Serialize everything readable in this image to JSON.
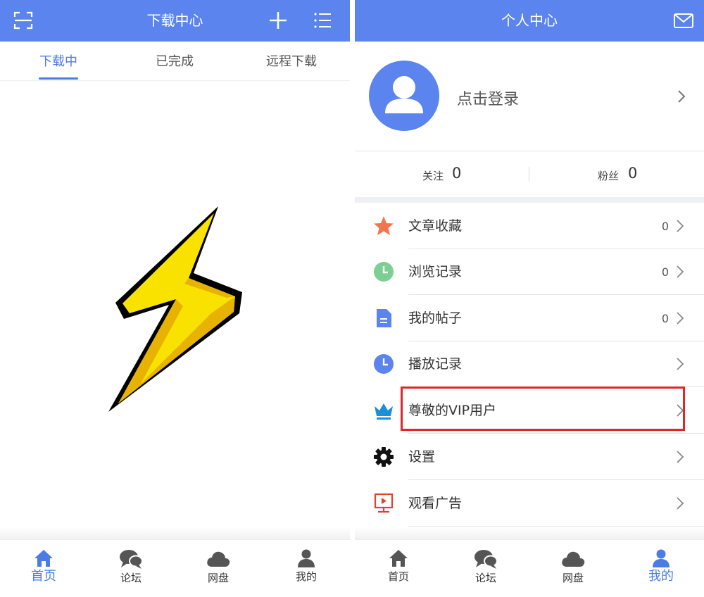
{
  "left": {
    "header": {
      "title": "下载中心",
      "scan_icon": "scan-icon",
      "add_icon": "plus-icon",
      "list_icon": "list-icon"
    },
    "tabs": [
      {
        "label": "下载中",
        "active": true
      },
      {
        "label": "已完成",
        "active": false
      },
      {
        "label": "远程下载",
        "active": false
      }
    ],
    "logo": "lightning-bolt-logo",
    "nav": [
      {
        "label": "首页",
        "icon": "home-icon",
        "active": true
      },
      {
        "label": "论坛",
        "icon": "chat-icon",
        "active": false
      },
      {
        "label": "网盘",
        "icon": "cloud-icon",
        "active": false
      },
      {
        "label": "我的",
        "icon": "user-icon",
        "active": false
      }
    ]
  },
  "right": {
    "header": {
      "title": "个人中心",
      "mail_icon": "mail-icon"
    },
    "profile": {
      "login_text": "点击登录",
      "avatar_icon": "avatar-icon"
    },
    "stats": {
      "following": {
        "label": "关注",
        "value": "0"
      },
      "followers": {
        "label": "粉丝",
        "value": "0"
      }
    },
    "menu": [
      {
        "label": "文章收藏",
        "count": "0",
        "icon": "star-icon"
      },
      {
        "label": "浏览记录",
        "count": "0",
        "icon": "clock-icon"
      },
      {
        "label": "我的帖子",
        "count": "0",
        "icon": "document-icon"
      },
      {
        "label": "播放记录",
        "count": "",
        "icon": "play-history-icon"
      },
      {
        "label": "尊敬的VIP用户",
        "count": "",
        "icon": "crown-icon"
      },
      {
        "label": "设置",
        "count": "",
        "icon": "gear-icon"
      },
      {
        "label": "观看广告",
        "count": "",
        "icon": "ad-screen-icon"
      }
    ],
    "nav": [
      {
        "label": "首页",
        "icon": "home-icon",
        "active": false
      },
      {
        "label": "论坛",
        "icon": "chat-icon",
        "active": false
      },
      {
        "label": "网盘",
        "icon": "cloud-icon",
        "active": false
      },
      {
        "label": "我的",
        "icon": "user-icon",
        "active": true
      }
    ]
  },
  "colors": {
    "accent": "#5b84ee",
    "active_text": "#4a7be6",
    "highlight": "#e0262b",
    "star": "#f5734f",
    "clock": "#7ccf93",
    "bolt": "#f9e200"
  }
}
